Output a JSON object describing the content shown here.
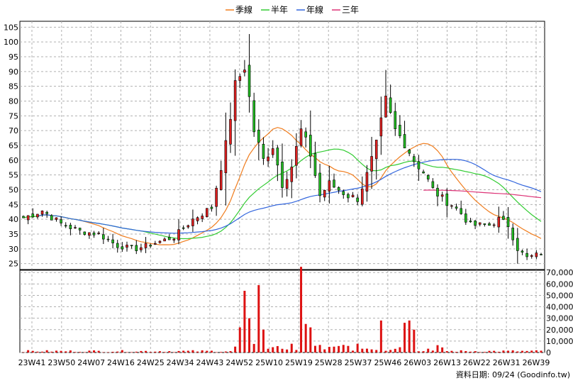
{
  "chart_data": {
    "type": "candlestick",
    "legend": [
      {
        "name": "季線",
        "color": "#f07d1e"
      },
      {
        "name": "半年",
        "color": "#33cc33"
      },
      {
        "name": "年線",
        "color": "#3366dd"
      },
      {
        "name": "三年",
        "color": "#dd3377"
      }
    ],
    "price_axis": {
      "ticks": [
        25,
        30,
        35,
        40,
        45,
        50,
        55,
        60,
        65,
        70,
        75,
        80,
        85,
        90,
        95,
        100,
        105
      ],
      "range": [
        23,
        107
      ]
    },
    "volume_axis": {
      "ticks": [
        0,
        10000,
        20000,
        30000,
        40000,
        50000,
        60000,
        70000
      ],
      "tick_labels": [
        "0",
        "10,000",
        "20,000",
        "30,000",
        "40,000",
        "50,000",
        "60,000",
        "70,000"
      ],
      "range": [
        0,
        72000
      ]
    },
    "week_labels": [
      "23W41",
      "23W50",
      "24W07",
      "24W16",
      "24W25",
      "24W34",
      "24W43",
      "24W52",
      "25W10",
      "25W19",
      "25W28",
      "25W37",
      "25W46",
      "26W03",
      "26W13",
      "26W22",
      "26W31",
      "26W39"
    ],
    "ohlc_keys": [
      [
        0,
        40.5
      ],
      [
        4,
        43
      ],
      [
        8,
        38.5
      ],
      [
        12,
        36
      ],
      [
        16,
        35
      ],
      [
        20,
        31
      ],
      [
        24,
        30
      ],
      [
        28,
        32
      ],
      [
        32,
        34
      ],
      [
        36,
        40
      ],
      [
        40,
        44
      ],
      [
        43,
        65
      ],
      [
        45,
        85
      ],
      [
        47,
        92
      ],
      [
        49,
        70
      ],
      [
        51,
        60
      ],
      [
        53,
        65
      ],
      [
        55,
        52
      ],
      [
        57,
        58
      ],
      [
        59,
        70
      ],
      [
        61,
        62
      ],
      [
        63,
        48
      ],
      [
        65,
        52
      ],
      [
        67,
        50
      ],
      [
        69,
        48
      ],
      [
        71,
        47
      ],
      [
        73,
        55
      ],
      [
        75,
        65
      ],
      [
        77,
        80
      ],
      [
        79,
        70
      ],
      [
        81,
        66
      ],
      [
        83,
        60
      ],
      [
        85,
        56
      ],
      [
        87,
        50
      ],
      [
        89,
        47
      ],
      [
        91,
        45
      ],
      [
        93,
        42
      ],
      [
        95,
        38
      ],
      [
        97,
        38
      ],
      [
        99,
        38
      ],
      [
        101,
        40
      ],
      [
        103,
        38
      ],
      [
        105,
        30
      ],
      [
        107,
        27
      ],
      [
        109,
        28
      ],
      [
        110,
        28.5
      ]
    ],
    "volume_spikes": [
      [
        46,
        22000
      ],
      [
        47,
        54000
      ],
      [
        48,
        30000
      ],
      [
        50,
        59000
      ],
      [
        51,
        20000
      ],
      [
        59,
        75000
      ],
      [
        60,
        25000
      ],
      [
        61,
        22000
      ],
      [
        76,
        28000
      ],
      [
        81,
        26000
      ],
      [
        82,
        28000
      ],
      [
        83,
        20000
      ]
    ],
    "source_label": "資料日期: 09/24 (Goodinfo.tw)"
  }
}
